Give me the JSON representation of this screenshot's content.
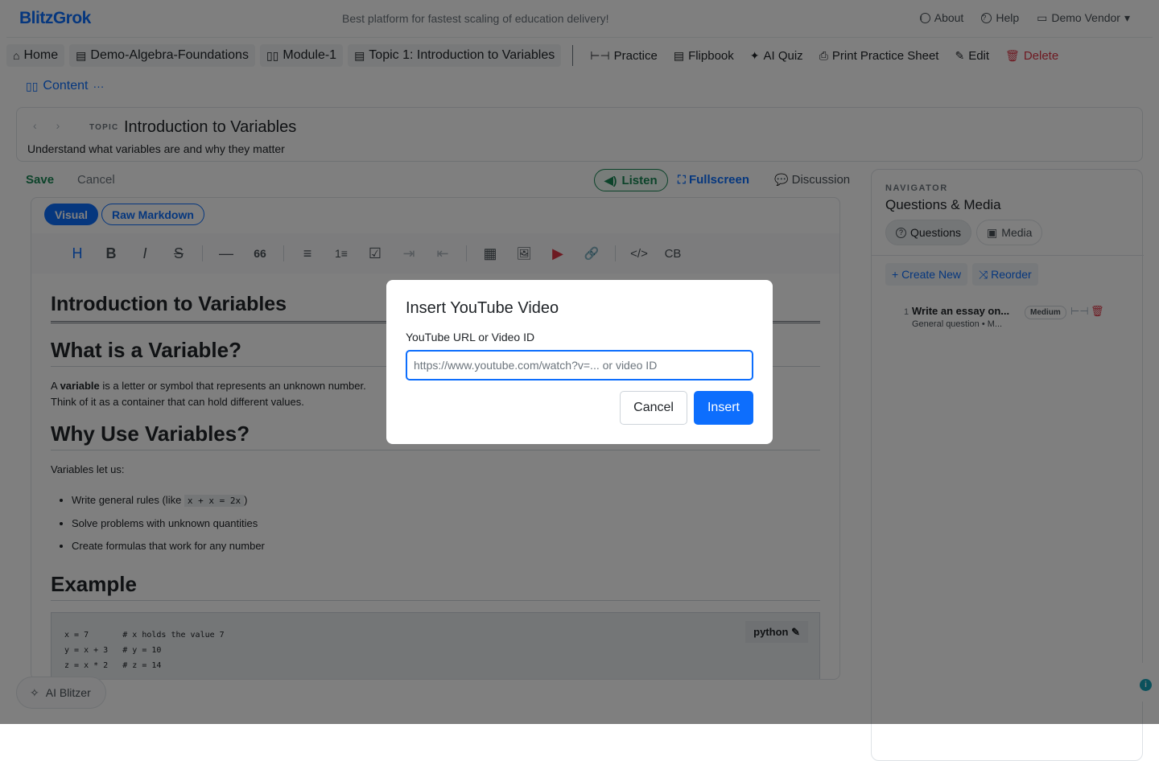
{
  "app": {
    "logo": "BlitzGrok",
    "tagline": "Best platform for fastest scaling of education delivery!",
    "links": {
      "about": "About",
      "help": "Help",
      "vendor": "Demo Vendor"
    }
  },
  "breadcrumb": {
    "home": "Home",
    "course": "Demo-Algebra-Foundations",
    "module": "Module-1",
    "topic": "Topic 1: Introduction to Variables"
  },
  "actions": {
    "practice": "Practice",
    "flipbook": "Flipbook",
    "ai_quiz": "AI Quiz",
    "print": "Print Practice Sheet",
    "edit": "Edit",
    "delete": "Delete",
    "content": "Content"
  },
  "header": {
    "tag": "TOPIC",
    "title": "Introduction to Variables",
    "subtitle": "Understand what variables are and why they matter"
  },
  "editor_toolbar": {
    "save": "Save",
    "cancel": "Cancel",
    "listen": "Listen",
    "fullscreen": "Fullscreen",
    "discussion": "Discussion"
  },
  "modes": {
    "visual": "Visual",
    "raw": "Raw Markdown"
  },
  "format_buttons": [
    "H",
    "B",
    "I",
    "S",
    "—",
    "66",
    "≡",
    "1≡",
    "☑",
    "⇥",
    "⇤",
    "▦",
    "🖼",
    "▶",
    "🔗",
    "</>",
    "CB"
  ],
  "document": {
    "h1": "Introduction to Variables",
    "h2_a": "What is a Variable?",
    "p1_pre": "A ",
    "p1_bold": "variable",
    "p1_post": " is a letter or symbol that represents an unknown number.",
    "p2": "Think of it as a container that can hold different values.",
    "h2_b": "Why Use Variables?",
    "p3": "Variables let us:",
    "li1_pre": "Write general rules (like ",
    "li1_code": "x + x = 2x",
    "li1_post": ")",
    "li2": "Solve problems with unknown quantities",
    "li3": "Create formulas that work for any number",
    "h2_c": "Example",
    "code": "x = 7       # x holds the value 7\ny = x + 3   # y = 10\nz = x * 2   # z = 14",
    "code_lang": "python"
  },
  "ai_button": "AI Blitzer",
  "navigator": {
    "tag": "NAVIGATOR",
    "title": "Questions & Media",
    "tabs": {
      "questions": "Questions",
      "media": "Media"
    },
    "create": "+ Create New",
    "reorder": "Reorder",
    "questions": [
      {
        "num": "1",
        "title": "Write an essay on...",
        "meta": "General question • M...",
        "level": "Medium"
      }
    ]
  },
  "modal": {
    "title": "Insert YouTube Video",
    "label": "YouTube URL or Video ID",
    "placeholder": "https://www.youtube.com/watch?v=... or video ID",
    "cancel": "Cancel",
    "insert": "Insert"
  },
  "colors": {
    "primary": "#0d6efd",
    "success": "#198754",
    "danger": "#dc3545",
    "youtube": "#dc3545"
  }
}
